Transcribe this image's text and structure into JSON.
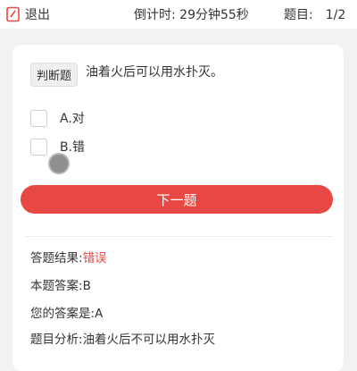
{
  "topbar": {
    "exit_label": "退出",
    "timer_label": "倒计时:",
    "timer_value": "29分钟55秒",
    "progress_label": "题目:",
    "progress_value": "1/2"
  },
  "question": {
    "type": "判断题",
    "text": "油着火后可以用水扑灭。",
    "options": [
      {
        "label": "A.对"
      },
      {
        "label": "B.错"
      }
    ]
  },
  "next_button": "下一题",
  "result": {
    "result_label": "答题结果:",
    "result_value": "错误",
    "answer_label": "本题答案:",
    "answer_value": "B",
    "your_answer_label": "您的答案是:",
    "your_answer_value": "A",
    "analysis_label": "题目分析:",
    "analysis_value": "油着火后不可以用水扑灭"
  },
  "colors": {
    "accent": "#e84843",
    "background": "#f2f2f2"
  },
  "icons": {
    "exit": "exit-icon"
  }
}
